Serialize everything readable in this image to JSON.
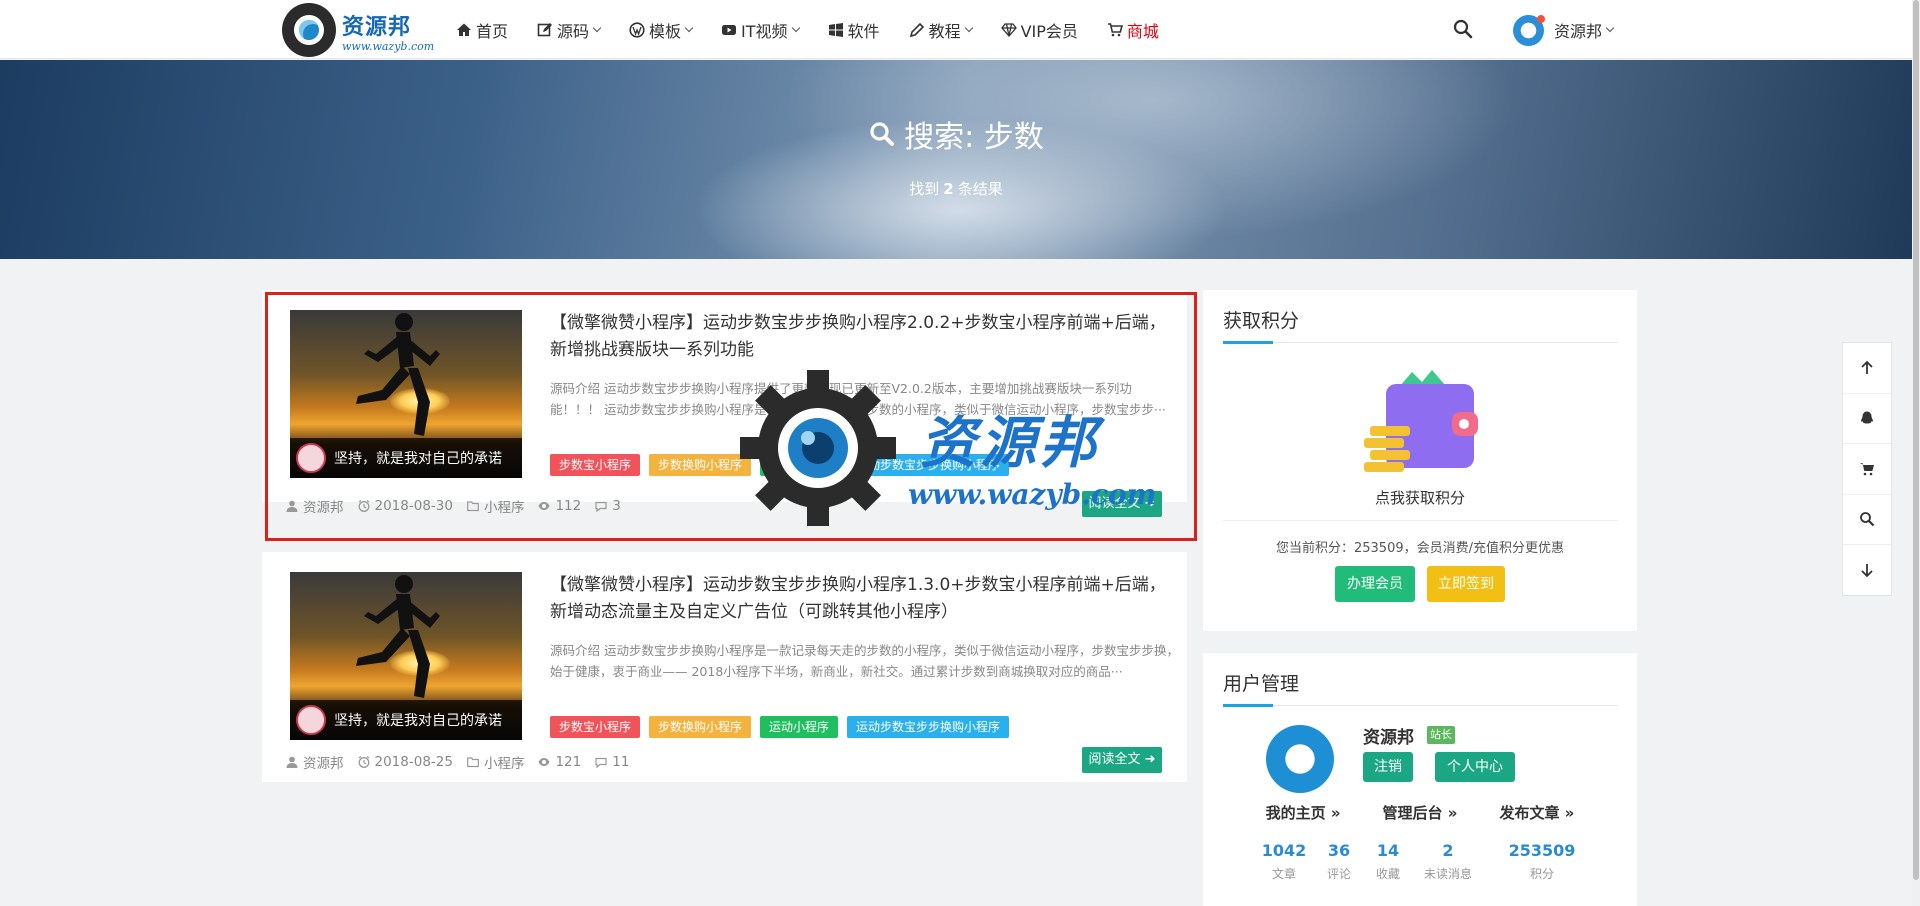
{
  "header": {
    "logo": {
      "text": "资源邦",
      "url": "www.wazyb.com"
    },
    "nav": [
      {
        "label": "首页",
        "icon": "home-icon",
        "dropdown": false
      },
      {
        "label": "源码",
        "icon": "edit-icon",
        "dropdown": true
      },
      {
        "label": "模板",
        "icon": "wordpress-icon",
        "dropdown": true
      },
      {
        "label": "IT视频",
        "icon": "youtube-icon",
        "dropdown": true
      },
      {
        "label": "软件",
        "icon": "windows-icon",
        "dropdown": false
      },
      {
        "label": "教程",
        "icon": "pencil-icon",
        "dropdown": true
      },
      {
        "label": "VIP会员",
        "icon": "diamond-icon",
        "dropdown": false
      },
      {
        "label": "商城",
        "icon": "cart-icon",
        "dropdown": false
      }
    ],
    "user_name": "资源邦"
  },
  "banner": {
    "title": "搜索: 步数",
    "sub_pre": "找到",
    "sub_count": "2",
    "sub_post": "条结果"
  },
  "posts": [
    {
      "title": "【微擎微赞小程序】运动步数宝步步换购小程序2.0.2+步数宝小程序前端+后端，新增挑战赛版块一系列功能",
      "excerpt": "源码介绍 运动步数宝步步换购小程序提供了更新，现已更新至V2.0.2版本，主要增加挑战赛版块一系列功能！！！ 运动步数宝步步换购小程序是一款记录每天走的步数的小程序，类似于微信运动小程序，步数宝步步···",
      "thumb_text": "坚持，就是我对自己的承诺",
      "tags": [
        "步数宝小程序",
        "步数换购小程序",
        "运动小程序",
        "运动步数宝步步换购小程序"
      ],
      "author": "资源邦",
      "date": "2018-08-30",
      "category": "小程序",
      "views": "112",
      "comments": "3",
      "read_label": "阅读全文"
    },
    {
      "title": "【微擎微赞小程序】运动步数宝步步换购小程序1.3.0+步数宝小程序前端+后端，新增动态流量主及自定义广告位（可跳转其他小程序）",
      "excerpt": "源码介绍 运动步数宝步步换购小程序是一款记录每天走的步数的小程序，类似于微信运动小程序，步数宝步步换，始于健康，衷于商业—— 2018小程序下半场，新商业，新社交。通过累计步数到商城换取对应的商品···",
      "thumb_text": "坚持，就是我对自己的承诺",
      "tags": [
        "步数宝小程序",
        "步数换购小程序",
        "运动小程序",
        "运动步数宝步步换购小程序"
      ],
      "author": "资源邦",
      "date": "2018-08-25",
      "category": "小程序",
      "views": "121",
      "comments": "11",
      "read_label": "阅读全文"
    }
  ],
  "tag_colors": [
    "#f0545a",
    "#f4b23e",
    "#1fbf5f",
    "#2bb0ef"
  ],
  "points_widget": {
    "title": "获取积分",
    "link": "点我获取积分",
    "current_text": "您当前积分：253509，会员消费/充值积分更优惠",
    "btn_member": "办理会员",
    "btn_signin": "立即签到"
  },
  "user_widget": {
    "title": "用户管理",
    "name": "资源邦",
    "badge": "站长",
    "btn_logout": "注销",
    "btn_center": "个人中心",
    "links": [
      "我的主页 »",
      "管理后台 »",
      "发布文章 »"
    ],
    "stats": [
      {
        "value": "1042",
        "label": "文章"
      },
      {
        "value": "36",
        "label": "评论"
      },
      {
        "value": "14",
        "label": "收藏"
      },
      {
        "value": "2",
        "label": "未读消息"
      },
      {
        "value": "253509",
        "label": "积分"
      }
    ]
  },
  "watermark": {
    "text": "资源邦",
    "url": "www.wazyb.com"
  },
  "float_toolbar": [
    "arrow-up-icon",
    "qq-icon",
    "cart-icon",
    "search-icon",
    "arrow-down-icon"
  ]
}
